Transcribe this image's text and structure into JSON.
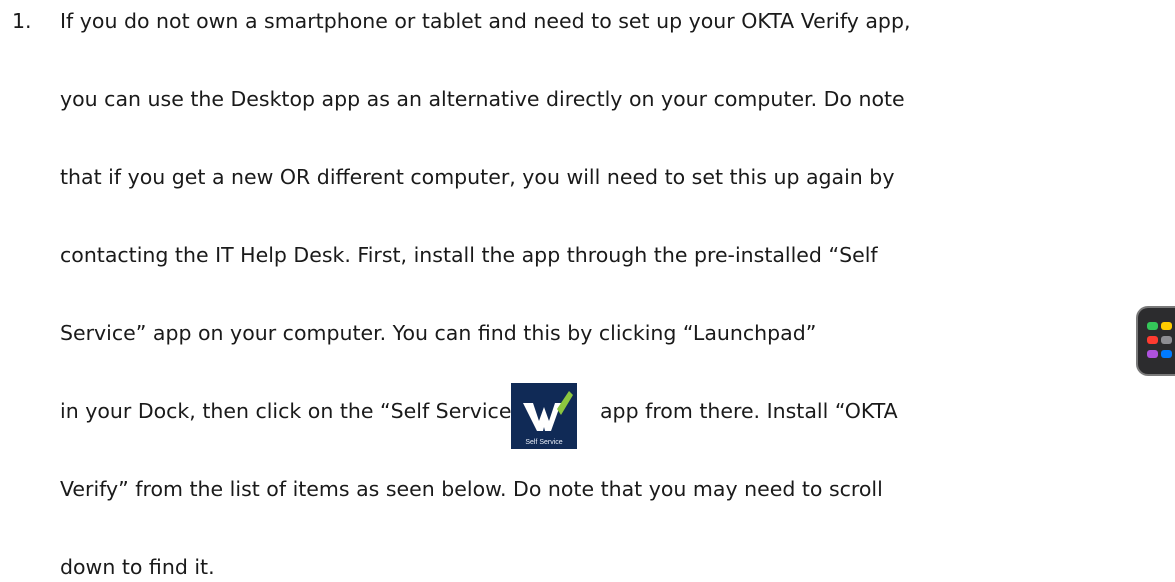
{
  "list": {
    "number": "1.",
    "lines": [
      "If you do not own a smartphone or tablet and need to set up your OKTA Verify app,",
      "you can use the Desktop app as an alternative directly on your computer. Do note",
      "that if you get a new OR different computer, you will need to set this up again by",
      "contacting the IT Help Desk. First, install the app through the pre-installed “Self",
      "Service” app on your computer. You can find this by clicking “Launchpad”",
      "in your Dock, then click on the “Self Service”",
      "app from there. Install “OKTA",
      "Verify” from the list of items as seen below. Do note that you may need to scroll",
      "down to find it."
    ]
  },
  "icons": {
    "launchpad": "launchpad-icon",
    "self_service": "self-service-icon",
    "self_service_caption": "Self Service"
  },
  "colors": {
    "text": "#1a1a1a",
    "self_service_bg": "#102a56",
    "self_service_check": "#8cc63f",
    "launchpad_bg": "#2c2c2e"
  }
}
